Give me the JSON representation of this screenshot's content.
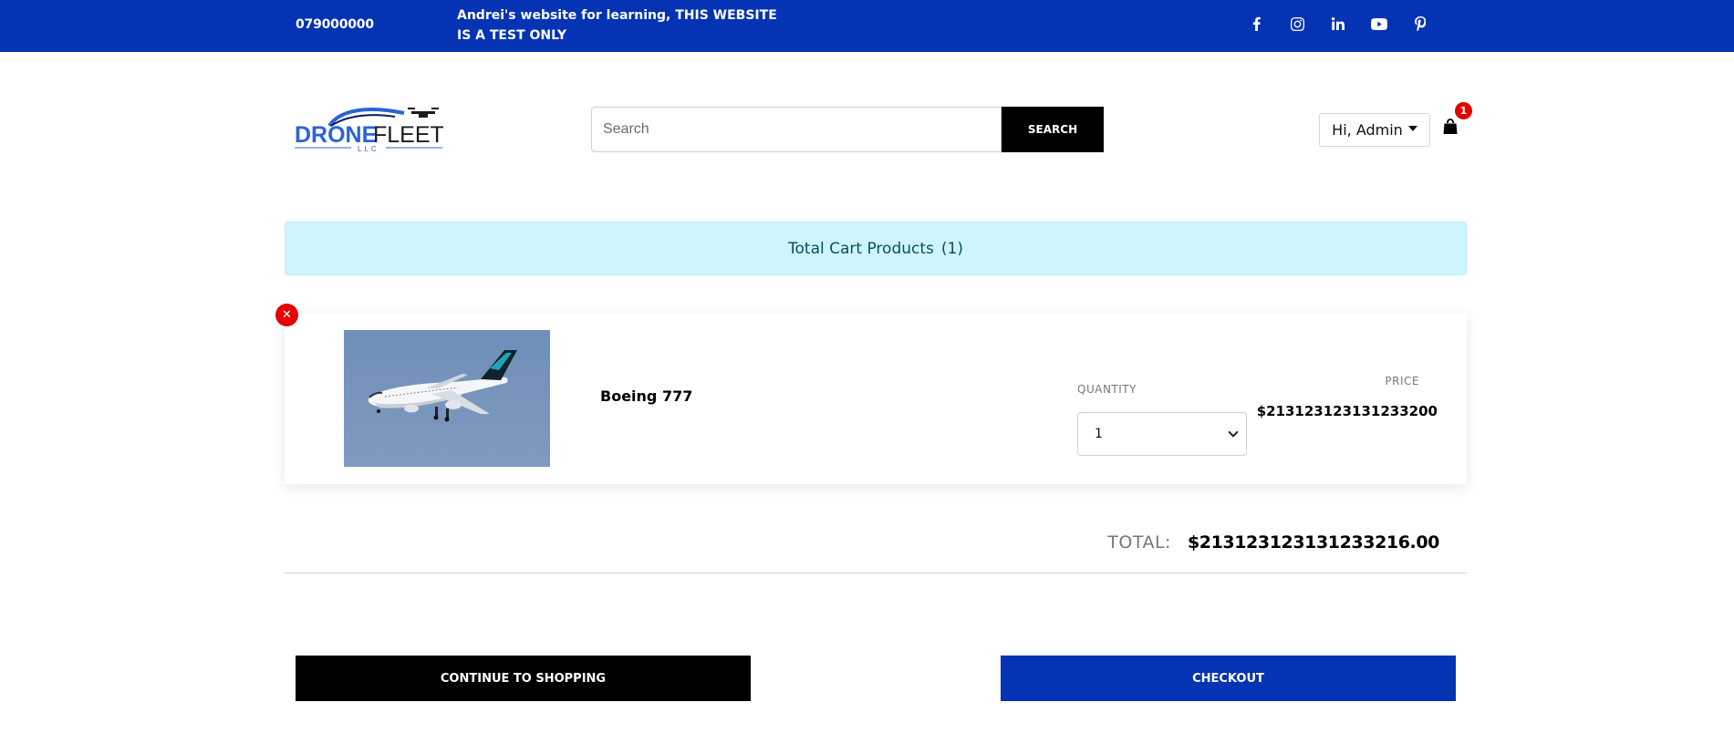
{
  "topbar": {
    "phone": "079000000",
    "notice": "Andrei's website for learning, THIS WEBSITE IS A TEST ONLY",
    "social": [
      "facebook-icon",
      "instagram-icon",
      "linkedin-icon",
      "youtube-icon",
      "pinterest-icon"
    ],
    "background": "#0433b3"
  },
  "header": {
    "logo": {
      "primary": "DRONE",
      "secondary": "FLEET",
      "suffix": "LLC"
    },
    "search_placeholder": "Search",
    "search_button": "SEARCH",
    "user_menu": "Hi, Admin",
    "cart_count": "1"
  },
  "cart": {
    "summary_label": "Total Cart Products",
    "summary_count": "(1)",
    "items": [
      {
        "name": "Boeing 777",
        "quantity_label": "QUANTITY",
        "quantity": "1",
        "price_label": "PRICE",
        "price": "$213123123131233200"
      }
    ],
    "total_label": "TOTAL:",
    "total_value": "$213123123131233216.00"
  },
  "actions": {
    "continue": "CONTINUE TO SHOPPING",
    "checkout": "CHECKOUT"
  },
  "colors": {
    "brand_blue": "#0433b3",
    "alert_bg": "#cff4fc",
    "danger": "#e60000"
  }
}
